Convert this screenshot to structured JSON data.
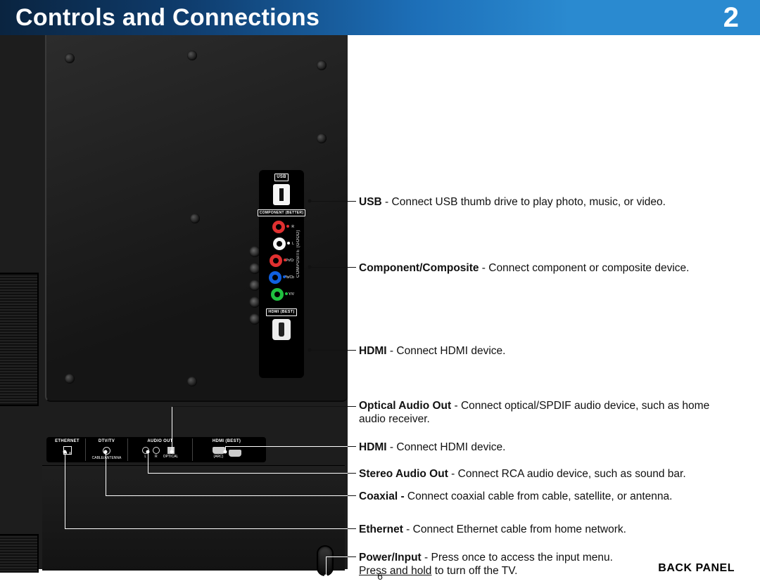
{
  "header": {
    "title": "Controls and Connections",
    "chapter": "2"
  },
  "page_number": "6",
  "panel_label": "BACK PANEL",
  "side_ports": {
    "usb_label": "USB",
    "component_label": "COMPONENT\n(BETTER)",
    "composite_label": "COMPOSITE (GOOD)",
    "hdmi_label": "HDMI (BEST)",
    "rca": {
      "r": "R",
      "l": "L",
      "pr": "Pr/Cr",
      "pb": "Pb/Cb",
      "y": "Y/V"
    }
  },
  "bottom_ports": {
    "ethernet": "ETHERNET",
    "dtv": "DTV/TV",
    "dtv_sub": "CABLE/ANTENNA",
    "audio": "AUDIO OUT",
    "audio_l": "L",
    "audio_r": "R",
    "audio_opt": "OPTICAL",
    "hdmi": "HDMI (BEST)",
    "hdmi_sub": "(ARC)"
  },
  "callouts": {
    "usb": {
      "bold": "USB",
      "text": " - Connect USB thumb drive to play photo, music, or video."
    },
    "component": {
      "bold": "Component/Composite",
      "text": " - Connect component or composite device."
    },
    "hdmi_side": {
      "bold": "HDMI",
      "text": " - Connect HDMI device."
    },
    "optical": {
      "bold": "Optical Audio Out",
      "text": " - Connect optical/SPDIF audio device, such as home audio receiver."
    },
    "hdmi_bottom": {
      "bold": "HDMI",
      "text": " - Connect HDMI device."
    },
    "stereo": {
      "bold": "Stereo Audio Out",
      "text": " - Connect RCA audio device, such as sound bar."
    },
    "coax": {
      "bold": "Coaxial - ",
      "text": "Connect coaxial cable from cable, satellite, or antenna."
    },
    "ethernet": {
      "bold": "Ethernet",
      "text": " - Connect Ethernet cable from home network."
    },
    "power": {
      "bold": "Power/Input",
      "text": " - Press once to access the input menu.",
      "line2_underline": "Press and hold",
      "line2_rest": " to turn off the TV."
    }
  }
}
